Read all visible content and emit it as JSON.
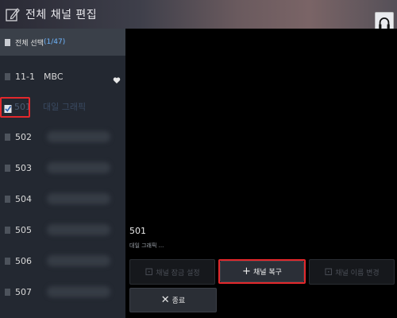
{
  "window": {
    "title": "전체 채널 편집"
  },
  "sidebar": {
    "select_all": {
      "label": "전체 선택",
      "count": "(1/47)"
    },
    "channels": [
      {
        "num": "11-1",
        "name": "MBC",
        "favorite": true,
        "checked": false,
        "selected": false
      },
      {
        "num": "501",
        "name": "대일 그래픽",
        "favorite": false,
        "checked": true,
        "selected": true
      },
      {
        "num": "502",
        "name": "",
        "favorite": false,
        "checked": false,
        "selected": false
      },
      {
        "num": "503",
        "name": "",
        "favorite": false,
        "checked": false,
        "selected": false
      },
      {
        "num": "504",
        "name": "",
        "favorite": false,
        "checked": false,
        "selected": false
      },
      {
        "num": "505",
        "name": "",
        "favorite": false,
        "checked": false,
        "selected": false
      },
      {
        "num": "506",
        "name": "",
        "favorite": false,
        "checked": false,
        "selected": false
      },
      {
        "num": "507",
        "name": "",
        "favorite": false,
        "checked": false,
        "selected": false
      }
    ]
  },
  "preview": {
    "channel_num": "501",
    "channel_name": "대일 그래픽 ..."
  },
  "actions": {
    "lock_label": "채널 잠금 설정",
    "restore_label": "채널 복구",
    "rename_label": "채널 이름 변경",
    "close_label": "종료"
  },
  "colors": {
    "highlight": "#e3282c",
    "count": "#6fb6ff"
  }
}
